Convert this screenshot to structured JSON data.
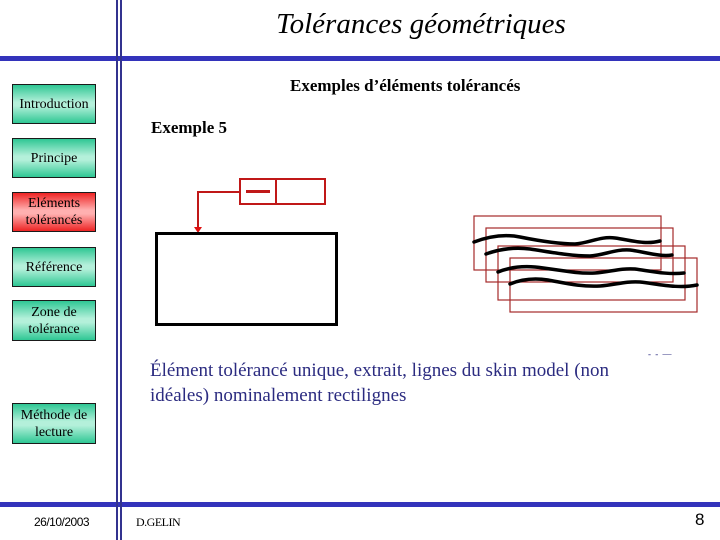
{
  "header": {
    "title": "Tolérances géométriques",
    "subtitle": "Exemples d’éléments tolérancés"
  },
  "sidebar": {
    "items": [
      {
        "label": "Introduction",
        "active": false
      },
      {
        "label": "Principe",
        "active": false
      },
      {
        "label": "Eléments tolérancés",
        "active": true
      },
      {
        "label": "Référence",
        "active": false
      },
      {
        "label": "Zone de tolérance",
        "active": false
      },
      {
        "label": "Méthode de lecture",
        "active": false
      }
    ]
  },
  "main": {
    "example_label": "Exemple 5",
    "caption": "Élément tolérancé unique, extrait, lignes du skin model (non idéales) nominalement rectilignes",
    "artifact_text": "- - —",
    "feature_control_frame": {
      "symbol": "straightness",
      "tolerance_value": ""
    },
    "skin_model_lines_count": 4
  },
  "footer": {
    "date": "26/10/2003",
    "author": "D.GELIN",
    "page_number": "8"
  },
  "colors": {
    "rule_blue": "#3333bb",
    "nav_green": "#2fc794",
    "nav_red": "#ee2424",
    "annotation_red": "#c01818",
    "caption_blue": "#2b2b80"
  }
}
